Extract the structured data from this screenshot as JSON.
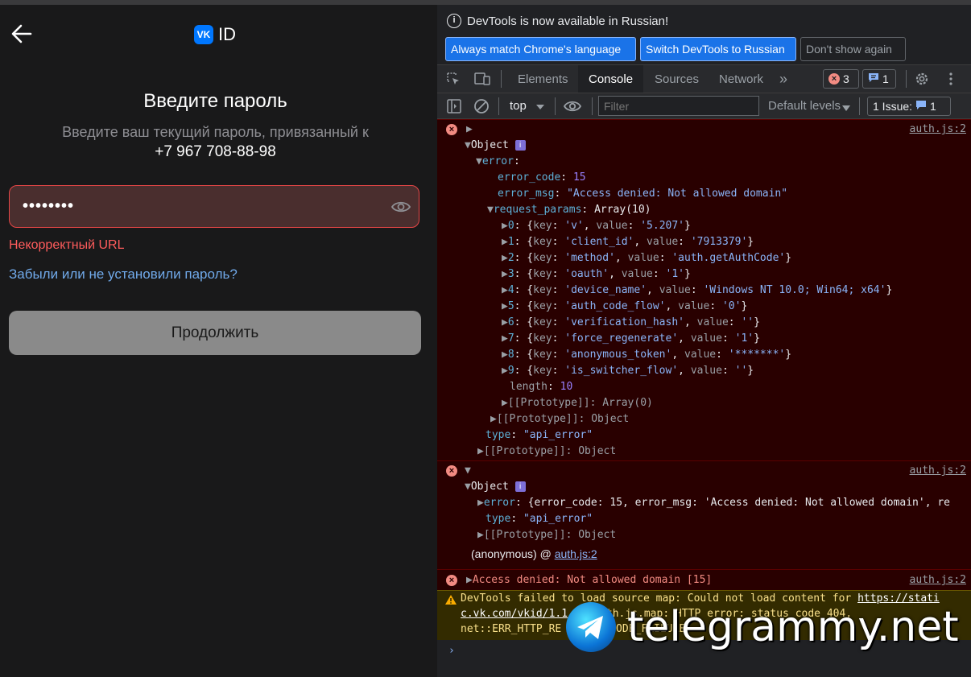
{
  "vk": {
    "logo_badge": "VK",
    "logo_text": "ID",
    "title": "Введите пароль",
    "subtitle": "Введите ваш текущий пароль, привязанный к",
    "phone": "+7 967 708-88-98",
    "password_value": "••••••••",
    "error": "Некорректный URL",
    "forgot_link": "Забыли или не установили пароль?",
    "continue_label": "Продолжить"
  },
  "devtools": {
    "banner": {
      "text": "DevTools is now available in Russian!",
      "btn_match": "Always match Chrome's language",
      "btn_switch": "Switch DevTools to Russian",
      "btn_dismiss": "Don't show again"
    },
    "tabs": [
      "Elements",
      "Console",
      "Sources",
      "Network"
    ],
    "active_tab": "Console",
    "more_tabs": "»",
    "error_count": "3",
    "message_count": "1",
    "context": "top",
    "filter_placeholder": "Filter",
    "levels": "Default levels",
    "issues_label": "1 Issue:",
    "issues_count": "1",
    "colors": {
      "error_bg": "#290000",
      "warn_bg": "#332b00",
      "accent": "#1a73e8"
    }
  },
  "console": {
    "source": "auth.js:2",
    "msg1": {
      "object": "Object",
      "error_key": "error",
      "error_code_key": "error_code",
      "error_code": "15",
      "error_msg_key": "error_msg",
      "error_msg": "\"Access denied: Not allowed domain\"",
      "request_params_key": "request_params",
      "request_params_type": "Array(10)",
      "params": [
        {
          "i": "0",
          "key": "'v'",
          "value": "'5.207'"
        },
        {
          "i": "1",
          "key": "'client_id'",
          "value": "'7913379'"
        },
        {
          "i": "2",
          "key": "'method'",
          "value": "'auth.getAuthCode'"
        },
        {
          "i": "3",
          "key": "'oauth'",
          "value": "'1'"
        },
        {
          "i": "4",
          "key": "'device_name'",
          "value": "'Windows NT 10.0; Win64; x64'"
        },
        {
          "i": "5",
          "key": "'auth_code_flow'",
          "value": "'0'"
        },
        {
          "i": "6",
          "key": "'verification_hash'",
          "value": "''"
        },
        {
          "i": "7",
          "key": "'force_regenerate'",
          "value": "'1'"
        },
        {
          "i": "8",
          "key": "'anonymous_token'",
          "value": "'*******'"
        },
        {
          "i": "9",
          "key": "'is_switcher_flow'",
          "value": "''"
        }
      ],
      "length_key": "length",
      "length": "10",
      "proto_array": "[[Prototype]]: Array(0)",
      "proto_object": "[[Prototype]]: Object",
      "type_key": "type",
      "type_value": "\"api_error\""
    },
    "msg2": {
      "object": "Object",
      "error_line_key": "error",
      "error_line": "{error_code: 15, error_msg: 'Access denied: Not allowed domain', re",
      "type_key": "type",
      "type_value": "\"api_error\"",
      "proto": "[[Prototype]]: Object",
      "trace_prefix": "(anonymous) @",
      "trace_link": "auth.js:2"
    },
    "msg3": {
      "text": "Access denied: Not allowed domain [15]"
    },
    "warn": {
      "line1_text": "DevTools failed to load source map: Could not load content for",
      "line1_link": "https://stati",
      "line2": "c.vk.com/vkid/1.1",
      "line2b": "uth.js.map: HTTP error: status code 404,",
      "line3": "net::ERR_HTTP_RE",
      "line3b": "CODE_FAILURE"
    },
    "prompt": "›"
  },
  "watermark": {
    "text": "telegrammy.net"
  }
}
